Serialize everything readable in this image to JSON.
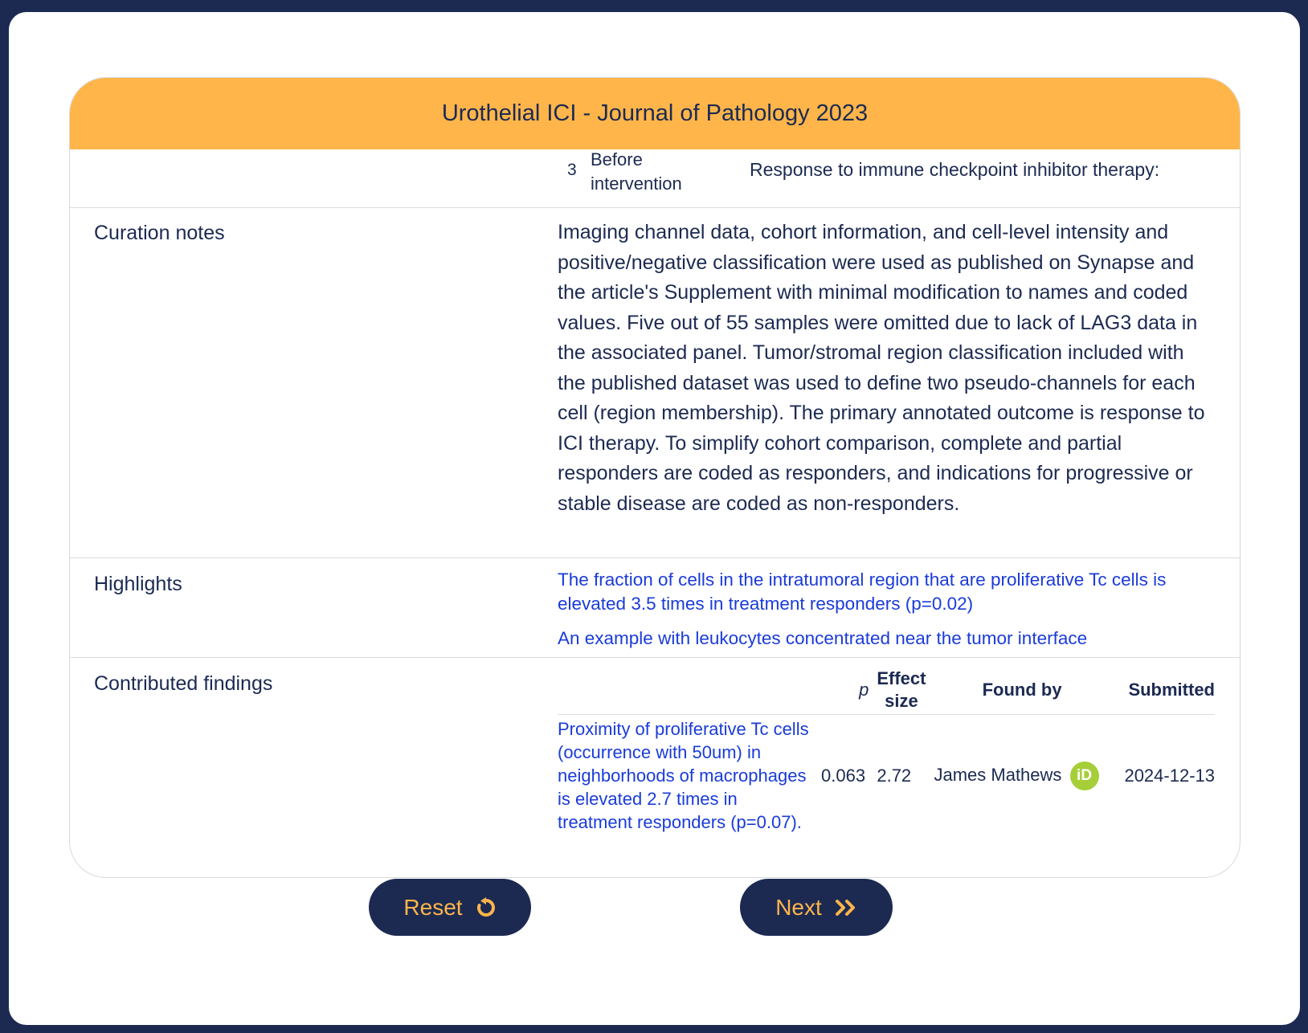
{
  "card": {
    "title": "Urothelial ICI - Journal of Pathology 2023"
  },
  "top_row": {
    "number": "3",
    "when": "Before intervention",
    "description": "Response to immune checkpoint inhibitor therapy:"
  },
  "curation_notes": {
    "label": "Curation notes",
    "text": "Imaging channel data, cohort information, and cell-level intensity and positive/negative classification were used as published on Synapse and the article's Supplement with minimal modification to names and coded values. Five out of 55 samples were omitted due to lack of LAG3 data in the associated panel. Tumor/stromal region classification included with the published dataset was used to define two pseudo-channels for each cell (region membership). The primary annotated outcome is response to ICI therapy. To simplify cohort comparison, complete and partial responders are coded as responders, and indications for progressive or stable disease are coded as non-responders."
  },
  "highlights": {
    "label": "Highlights",
    "items": [
      "The fraction of cells in the intratumoral region that are proliferative Tc cells is elevated 3.5 times in treatment responders (p=0.02)",
      "An example with leukocytes concentrated near the tumor interface"
    ]
  },
  "contributed_findings": {
    "label": "Contributed findings",
    "columns": {
      "p": "p",
      "effect_size": "Effect size",
      "found_by": "Found by",
      "submitted": "Submitted"
    },
    "rows": [
      {
        "finding": "Proximity of proliferative Tc cells (occurrence with 50um) in neighborhoods of macrophages is elevated 2.7 times in treatment responders (p=0.07).",
        "p": "0.063",
        "effect_size": "2.72",
        "found_by": "James Mathews",
        "orcid_icon": "orcid-icon",
        "orcid_label": "iD",
        "submitted": "2024-12-13"
      }
    ]
  },
  "buttons": {
    "reset": "Reset",
    "next": "Next"
  },
  "colors": {
    "navy": "#1c2a52",
    "accent": "#ffb54a",
    "link": "#1a3bd9",
    "orcid": "#a6ce39"
  }
}
